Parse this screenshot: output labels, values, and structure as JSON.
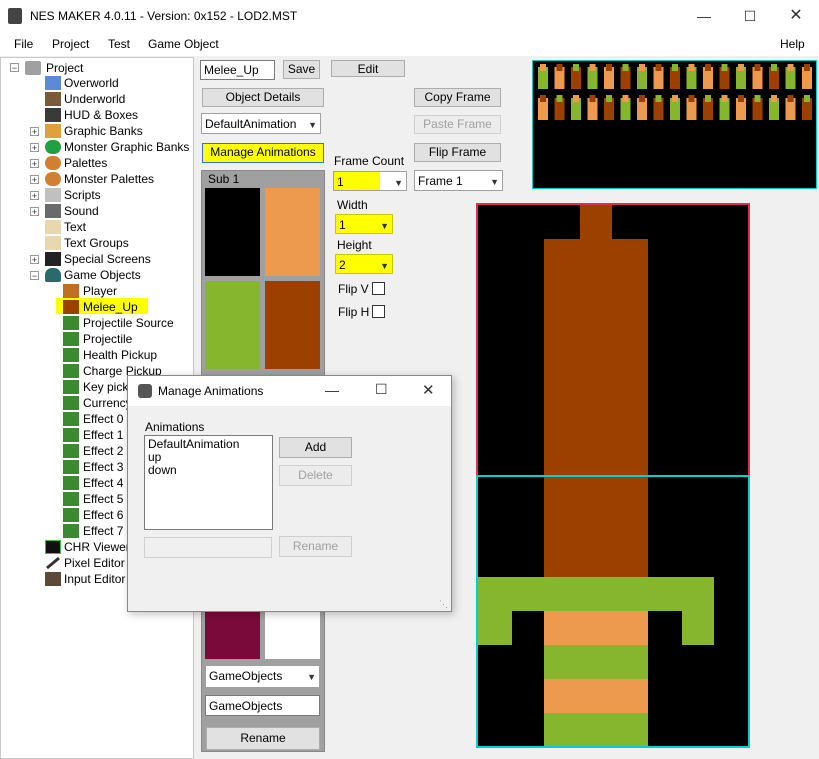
{
  "window": {
    "title": "NES MAKER 4.0.11 - Version: 0x152 - LOD2.MST"
  },
  "menu": {
    "file": "File",
    "project": "Project",
    "test": "Test",
    "game_object": "Game Object",
    "help": "Help"
  },
  "tree": {
    "root": "Project",
    "items": {
      "overworld": "Overworld",
      "underworld": "Underworld",
      "hud": "HUD & Boxes",
      "graphic_banks": "Graphic Banks",
      "monster_graphic_banks": "Monster Graphic Banks",
      "palettes": "Palettes",
      "monster_palettes": "Monster Palettes",
      "scripts": "Scripts",
      "sound": "Sound",
      "text": "Text",
      "text_groups": "Text Groups",
      "special_screens": "Special Screens",
      "game_objects": "Game Objects",
      "chr_viewer": "CHR Viewer",
      "pixel_editor": "Pixel Editor",
      "input_editor": "Input Editor"
    },
    "game_object_children": [
      "Player",
      "Melee_Up",
      "Projectile Source",
      "Projectile",
      "Health Pickup",
      "Charge Pickup",
      "Key pickup",
      "Currency",
      "Effect 0",
      "Effect 1",
      "Effect 2",
      "Effect 3",
      "Effect 4",
      "Effect 5",
      "Effect 6",
      "Effect 7"
    ],
    "selected": "Melee_Up"
  },
  "editor": {
    "name_value": "Melee_Up",
    "save": "Save",
    "edit": "Edit",
    "object_details": "Object Details",
    "animation_select": "DefaultAnimation",
    "manage_animations": "Manage Animations",
    "copy_frame": "Copy Frame",
    "paste_frame": "Paste Frame",
    "flip_frame": "Flip Frame",
    "frame_count_label": "Frame Count",
    "frame_count_value": "1",
    "frame_select": "Frame 1",
    "width_label": "Width",
    "width_value": "1",
    "height_label": "Height",
    "height_value": "2",
    "flipv_label": "Flip V",
    "fliph_label": "Flip H",
    "sub_label": "Sub 1",
    "palette_top": [
      "#000000",
      "#ee9a4e",
      "#86b52e",
      "#9c4000"
    ],
    "palette_bottom": [
      "#7a0a3a",
      "#ffffff"
    ],
    "bank_select": "GameObjects",
    "bank_name": "GameObjects",
    "rename": "Rename"
  },
  "dialog": {
    "title": "Manage Animations",
    "group_label": "Animations",
    "items": [
      "DefaultAnimation",
      "up",
      "down"
    ],
    "add": "Add",
    "delete": "Delete",
    "rename": "Rename",
    "rename_value": ""
  },
  "colors": {
    "highlight": "#ffff00",
    "cyan_border": "#00d0d0",
    "red_border": "#e03050",
    "brown": "#9c4000",
    "green": "#86b52e",
    "orange": "#ee9a4e"
  }
}
